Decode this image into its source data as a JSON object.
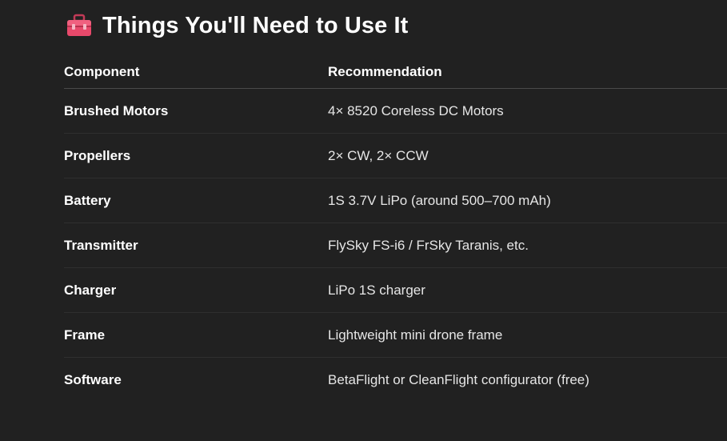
{
  "heading": {
    "icon": "toolbox-icon",
    "title": "Things You'll Need to Use It"
  },
  "table": {
    "headers": [
      "Component",
      "Recommendation"
    ],
    "rows": [
      {
        "component": "Brushed Motors",
        "recommendation": "4× 8520 Coreless DC Motors"
      },
      {
        "component": "Propellers",
        "recommendation": "2× CW, 2× CCW"
      },
      {
        "component": "Battery",
        "recommendation": "1S 3.7V LiPo (around 500–700 mAh)"
      },
      {
        "component": "Transmitter",
        "recommendation": "FlySky FS-i6 / FrSky Taranis, etc."
      },
      {
        "component": "Charger",
        "recommendation": "LiPo 1S charger"
      },
      {
        "component": "Frame",
        "recommendation": "Lightweight mini drone frame"
      },
      {
        "component": "Software",
        "recommendation": "BetaFlight or CleanFlight configurator (free)"
      }
    ]
  },
  "colors": {
    "background": "#212121",
    "text": "#ececec",
    "icon": "#e8496b"
  }
}
